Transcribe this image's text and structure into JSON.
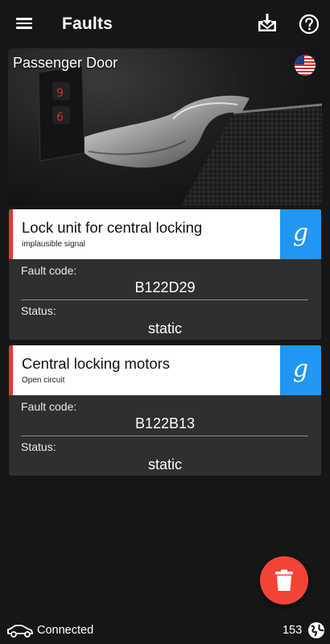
{
  "header": {
    "title": "Faults"
  },
  "hero": {
    "title": "Passenger Door"
  },
  "faults": [
    {
      "name": "Lock unit for central locking",
      "description": "implausible signal",
      "fault_code_label": "Fault code:",
      "fault_code": "B122D29",
      "status_label": "Status:",
      "status": "static",
      "search_icon": "g"
    },
    {
      "name": "Central locking motors",
      "description": "Open circuit",
      "fault_code_label": "Fault code:",
      "fault_code": "B122B13",
      "status_label": "Status:",
      "status": "static",
      "search_icon": "g"
    }
  ],
  "status_bar": {
    "connection": "Connected",
    "count": "153"
  },
  "colors": {
    "accent_red": "#f44336",
    "google_blue": "#2196f3",
    "card_bg": "#2f2f2f",
    "background": "#161616"
  },
  "icons": [
    "menu-icon",
    "download-icon",
    "help-icon",
    "us-flag-icon",
    "google-icon",
    "trash-icon",
    "car-icon",
    "globe-icon"
  ]
}
